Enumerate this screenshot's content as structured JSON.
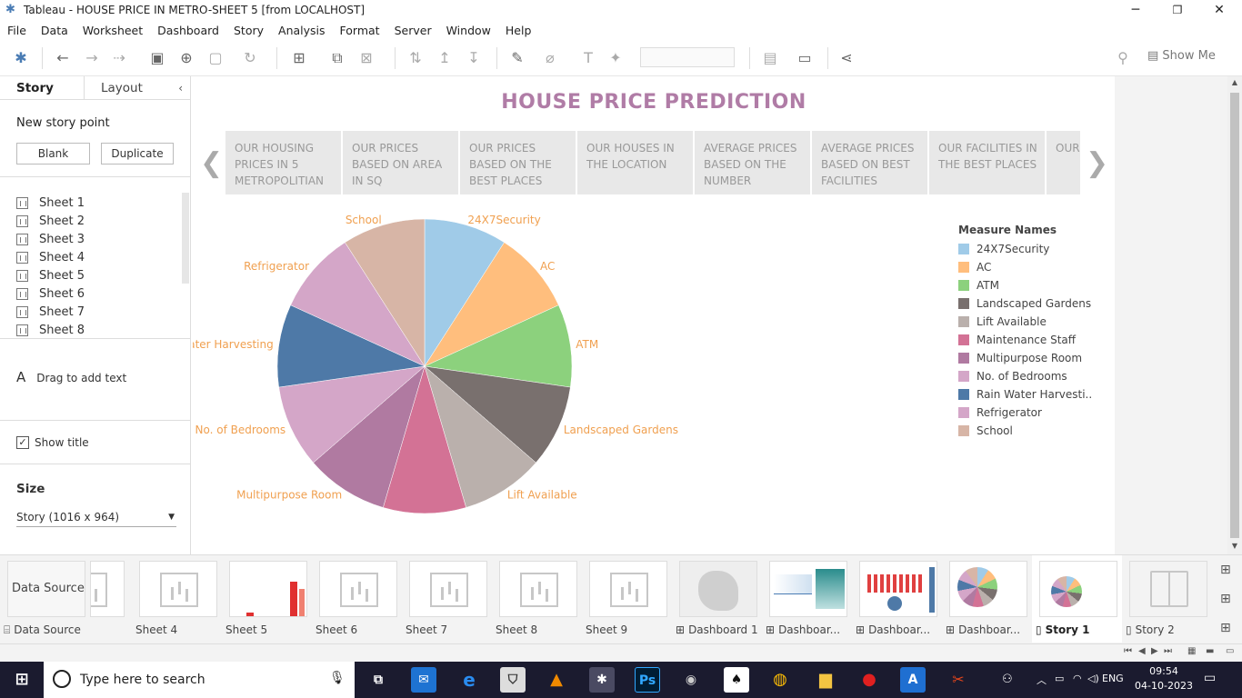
{
  "window": {
    "title": "Tableau - HOUSE PRICE IN METRO-SHEET 5 [from LOCALHOST]",
    "minimize": "─",
    "restore": "❐",
    "close": "✕"
  },
  "menu": [
    "File",
    "Data",
    "Worksheet",
    "Dashboard",
    "Story",
    "Analysis",
    "Format",
    "Server",
    "Window",
    "Help"
  ],
  "toolbar": {
    "show_me": "Show Me"
  },
  "left_pane": {
    "tabs": [
      "Story",
      "Layout"
    ],
    "collapse": "‹",
    "new_story_point": "New story point",
    "blank_button": "Blank",
    "duplicate_button": "Duplicate",
    "sheets": [
      "Sheet 1",
      "Sheet 2",
      "Sheet 3",
      "Sheet 4",
      "Sheet 5",
      "Sheet 6",
      "Sheet 7",
      "Sheet 8"
    ],
    "drag_text": "Drag to add text",
    "show_title": "Show title",
    "show_title_checked": true,
    "size_label": "Size",
    "size_value": "Story (1016 x 964)"
  },
  "story": {
    "title": "HOUSE PRICE PREDICTION",
    "points": [
      "OUR HOUSING PRICES IN 5 METROPOLITIAN",
      "OUR PRICES BASED ON AREA IN SQ",
      "OUR PRICES BASED ON THE BEST PLACES",
      "OUR HOUSES IN THE LOCATION",
      "AVERAGE PRICES BASED ON THE NUMBER",
      "AVERAGE  PRICES BASED ON BEST FACILITIES",
      "OUR FACILITIES IN THE BEST PLACES",
      "OUR BASE INTE"
    ]
  },
  "chart_data": {
    "type": "pie",
    "title": "",
    "legend_title": "Measure Names",
    "legend_placement": "right",
    "categories": [
      "24X7Security",
      "AC",
      "ATM",
      "Landscaped Gardens",
      "Lift Available",
      "Maintenance Staff",
      "Multipurpose Room",
      "No. of Bedrooms",
      "Rain Water Harvesting",
      "Refrigerator",
      "School"
    ],
    "legend_labels": [
      "24X7Security",
      "AC",
      "ATM",
      "Landscaped Gardens",
      "Lift Available",
      "Maintenance Staff",
      "Multipurpose Room",
      "No. of Bedrooms",
      "Rain Water Harvesti..",
      "Refrigerator",
      "School"
    ],
    "slice_labels": [
      "24X7Security",
      "AC",
      "ATM",
      "Landscaped Gardens",
      "Lift Available",
      "",
      "Multipurpose Room",
      "No. of Bedrooms",
      "Rain Water Harvesting",
      "Refrigerator",
      "School"
    ],
    "values": [
      1,
      1,
      1,
      1,
      1,
      1,
      1,
      1,
      1,
      1,
      1
    ],
    "colors": [
      "#a0cbe8",
      "#ffbe7d",
      "#8cd17d",
      "#79706e",
      "#bab0ac",
      "#d37295",
      "#b07aa1",
      "#d4a6c8",
      "#4e79a7",
      "#d4a6c8",
      "#d7b5a6"
    ],
    "label_color": "#f0a050"
  },
  "tabs": [
    {
      "label": "Data Source",
      "kind": "datasource",
      "icon": "⌸"
    },
    {
      "label": "",
      "kind": "sheet",
      "icon": ""
    },
    {
      "label": "Sheet 4",
      "kind": "sheet",
      "icon": ""
    },
    {
      "label": "Sheet 5",
      "kind": "sheet5",
      "icon": ""
    },
    {
      "label": "Sheet 6",
      "kind": "sheet",
      "icon": ""
    },
    {
      "label": "Sheet 7",
      "kind": "sheet",
      "icon": ""
    },
    {
      "label": "Sheet 8",
      "kind": "sheet",
      "icon": ""
    },
    {
      "label": "Sheet 9",
      "kind": "sheet",
      "icon": ""
    },
    {
      "label": "Dashboard 1",
      "kind": "dash-map",
      "icon": "⊞"
    },
    {
      "label": "Dashboar...",
      "kind": "dash-2",
      "icon": "⊞"
    },
    {
      "label": "Dashboar...",
      "kind": "dash-3",
      "icon": "⊞"
    },
    {
      "label": "Dashboar...",
      "kind": "dash-pie",
      "icon": "⊞"
    },
    {
      "label": "Story 1",
      "kind": "story-active",
      "icon": "▯"
    },
    {
      "label": "Story 2",
      "kind": "story",
      "icon": "▯"
    }
  ],
  "taskbar": {
    "search_placeholder": "Type here to search",
    "lang": "ENG",
    "time": "09:54",
    "date": "04-10-2023"
  }
}
